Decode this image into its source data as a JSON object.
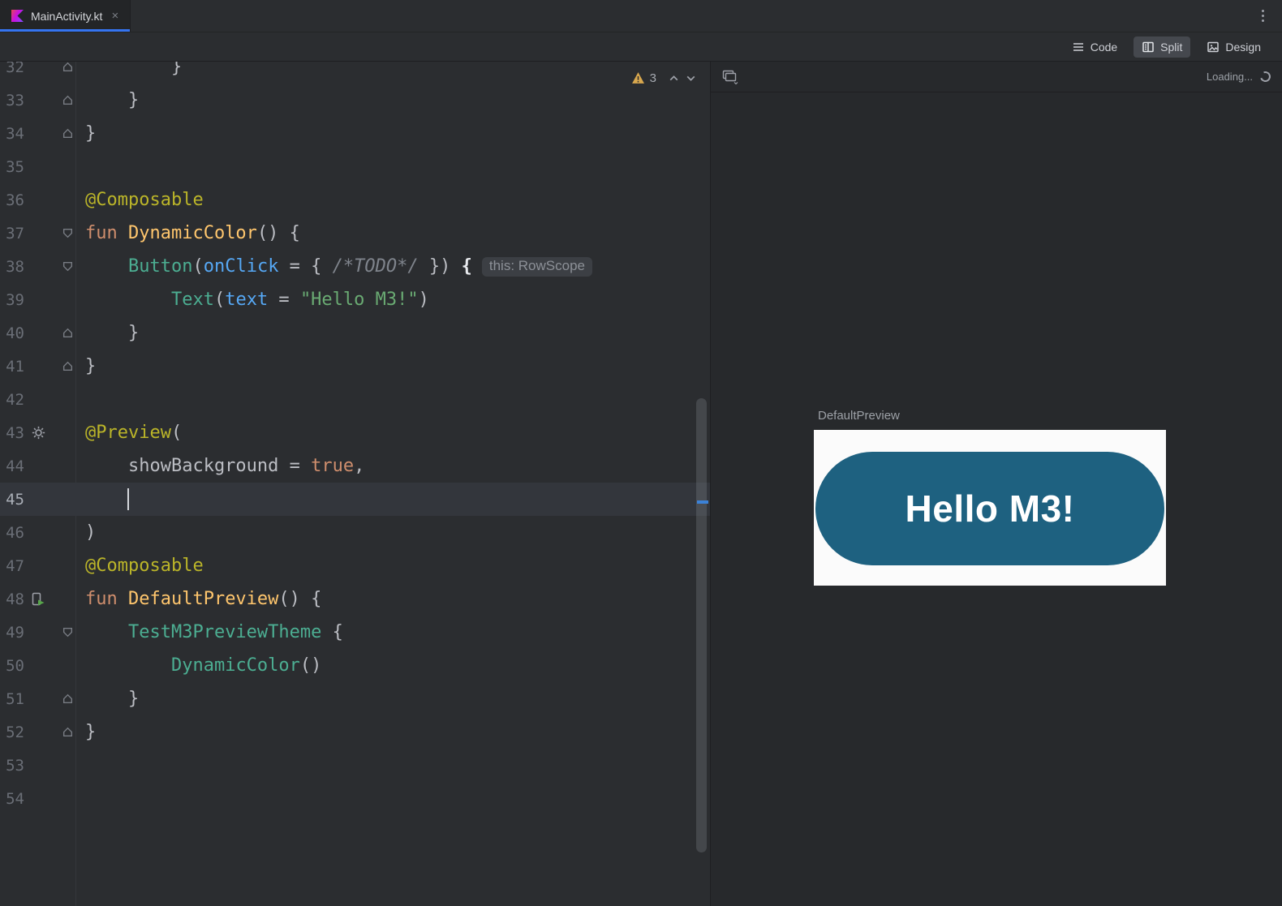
{
  "window": {
    "tab": {
      "label": "MainActivity.kt",
      "close_glyph": "×"
    },
    "view_modes": [
      {
        "id": "code",
        "label": "Code",
        "active": false
      },
      {
        "id": "split",
        "label": "Split",
        "active": true
      },
      {
        "id": "design",
        "label": "Design",
        "active": false
      }
    ]
  },
  "icons": {
    "tab_file": "kotlin-icon",
    "gutter": [
      "gear-icon",
      "compose-preview-run-icon"
    ],
    "editor_widget": [
      "warning-icon",
      "chevron-up-icon",
      "chevron-down-icon"
    ],
    "preview_toolbar": [
      "view-options-icon",
      "loading-spinner-icon"
    ]
  },
  "colors": {
    "tab_accent": "#3574F0",
    "preview_button": "#1E6180",
    "warning": "#D9A84E"
  },
  "editor": {
    "inspections": {
      "warning_count": "3"
    },
    "caret_line": 45,
    "lines": [
      {
        "num": 32,
        "fold": "up",
        "tokens": [
          [
            "d",
            "        }"
          ]
        ]
      },
      {
        "num": 33,
        "fold": "up",
        "tokens": [
          [
            "d",
            "    }"
          ]
        ]
      },
      {
        "num": 34,
        "fold": "up",
        "tokens": [
          [
            "d",
            "}"
          ]
        ]
      },
      {
        "num": 35,
        "tokens": []
      },
      {
        "num": 36,
        "tokens": [
          [
            "a",
            "@Composable"
          ]
        ]
      },
      {
        "num": 37,
        "fold": "down",
        "tokens": [
          [
            "k",
            "fun "
          ],
          [
            "f",
            "DynamicColor"
          ],
          [
            "d",
            "() {"
          ]
        ]
      },
      {
        "num": 38,
        "fold": "down",
        "tokens": [
          [
            "d",
            "    "
          ],
          [
            "c",
            "Button"
          ],
          [
            "d",
            "("
          ],
          [
            "p",
            "onClick"
          ],
          [
            "d",
            " = { "
          ],
          [
            "m",
            "/*TODO*/"
          ],
          [
            "d",
            " }) "
          ],
          [
            "b",
            "{"
          ]
        ],
        "hint": "this: RowScope"
      },
      {
        "num": 39,
        "tokens": [
          [
            "d",
            "        "
          ],
          [
            "c",
            "Text"
          ],
          [
            "d",
            "("
          ],
          [
            "p",
            "text"
          ],
          [
            "d",
            " = "
          ],
          [
            "s",
            "\"Hello M3!\""
          ],
          [
            "d",
            ")"
          ]
        ]
      },
      {
        "num": 40,
        "fold": "up",
        "tokens": [
          [
            "d",
            "    }"
          ]
        ]
      },
      {
        "num": 41,
        "fold": "up",
        "tokens": [
          [
            "d",
            "}"
          ]
        ]
      },
      {
        "num": 42,
        "tokens": []
      },
      {
        "num": 43,
        "icon": "gear",
        "tokens": [
          [
            "a",
            "@Preview"
          ],
          [
            "d",
            "("
          ]
        ]
      },
      {
        "num": 44,
        "tokens": [
          [
            "d",
            "    showBackground = "
          ],
          [
            "k",
            "true"
          ],
          [
            "d",
            ","
          ]
        ]
      },
      {
        "num": 45,
        "caret": true,
        "tokens": [
          [
            "d",
            "    "
          ]
        ]
      },
      {
        "num": 46,
        "tokens": [
          [
            "d",
            ")"
          ]
        ]
      },
      {
        "num": 47,
        "tokens": [
          [
            "a",
            "@Composable"
          ]
        ]
      },
      {
        "num": 48,
        "icon": "preview-run",
        "tokens": [
          [
            "k",
            "fun "
          ],
          [
            "f",
            "DefaultPreview"
          ],
          [
            "d",
            "() {"
          ]
        ]
      },
      {
        "num": 49,
        "fold": "down",
        "tokens": [
          [
            "d",
            "    "
          ],
          [
            "c",
            "TestM3PreviewTheme"
          ],
          [
            "d",
            " {"
          ]
        ]
      },
      {
        "num": 50,
        "tokens": [
          [
            "d",
            "        "
          ],
          [
            "c",
            "DynamicColor"
          ],
          [
            "d",
            "()"
          ]
        ]
      },
      {
        "num": 51,
        "fold": "up",
        "tokens": [
          [
            "d",
            "    }"
          ]
        ]
      },
      {
        "num": 52,
        "fold": "up",
        "tokens": [
          [
            "d",
            "}"
          ]
        ]
      },
      {
        "num": 53,
        "tokens": []
      },
      {
        "num": 54,
        "tokens": []
      }
    ]
  },
  "preview_panel": {
    "status": "Loading...",
    "preview_label": "DefaultPreview",
    "button": {
      "text": "Hello M3!",
      "color": "#1E6180"
    }
  }
}
